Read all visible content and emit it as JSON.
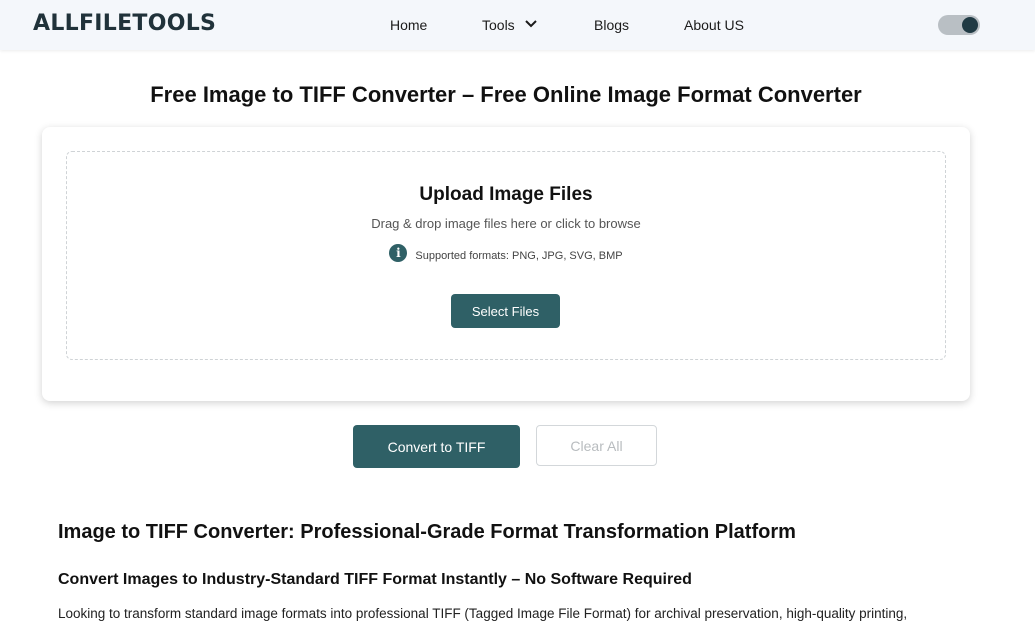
{
  "nav": {
    "logo": "ALLFILETOOLS",
    "home": "Home",
    "tools": "Tools",
    "blogs": "Blogs",
    "about": "About US"
  },
  "page": {
    "title": "Free Image to TIFF Converter – Free Online Image Format Converter"
  },
  "upload": {
    "title": "Upload Image Files",
    "subtitle": "Drag & drop image files here or click to browse",
    "formats": "Supported formats: PNG, JPG, SVG, BMP",
    "select_label": "Select Files"
  },
  "actions": {
    "convert_label": "Convert to TIFF",
    "clear_label": "Clear All"
  },
  "content": {
    "heading": "Image to TIFF Converter: Professional-Grade Format Transformation Platform",
    "subheading": "Convert Images to Industry-Standard TIFF Format Instantly – No Software Required",
    "paragraph": "Looking to transform standard image formats into professional TIFF (Tagged Image File Format) for archival preservation, high-quality printing,"
  },
  "colors": {
    "accent": "#2f6066",
    "nav_bg": "#f4f7fb"
  },
  "icons": {
    "tools_dropdown": "chevron-down-icon",
    "formats_info": "info-icon",
    "theme_toggle": "toggle-switch"
  }
}
